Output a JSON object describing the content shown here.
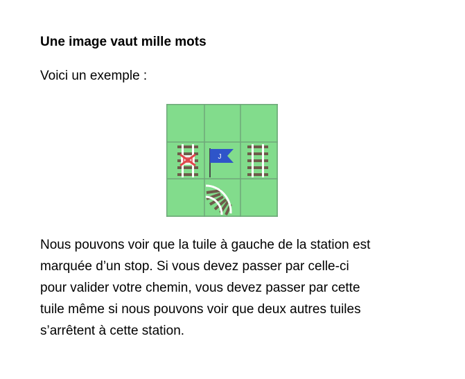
{
  "document": {
    "title": "Une image vaut mille mots",
    "intro": "Voici un exemple :",
    "paragraph_lines": [
      "Nous pouvons voir que la tuile à gauche de la station est",
      "marquée d’un stop. Si vous devez passer par celle-ci",
      "pour valider votre chemin, vous devez passer par cette",
      "tuile même si nous pouvons voir que deux autres tuiles",
      "s’arrêtent à cette station."
    ]
  },
  "tile_image": {
    "grid": {
      "rows": 3,
      "cols": 3
    },
    "station_flag_label": "J",
    "tiles": [
      {
        "row": 1,
        "col": 0,
        "kind": "vertical-track-with-stop"
      },
      {
        "row": 1,
        "col": 1,
        "kind": "station-flag"
      },
      {
        "row": 1,
        "col": 2,
        "kind": "vertical-track"
      },
      {
        "row": 2,
        "col": 1,
        "kind": "curved-track"
      }
    ],
    "colors": {
      "grass": "#82dc8c",
      "grid": "#6fa77a",
      "flag": "#2f55c9",
      "rail": "#6e5a4a",
      "stop": "#e0464c"
    }
  }
}
